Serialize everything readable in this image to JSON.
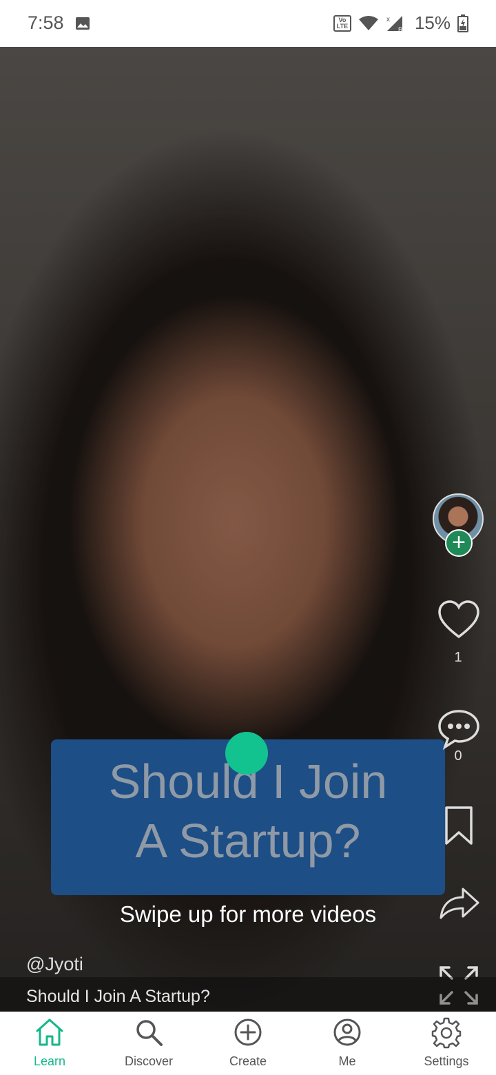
{
  "status_bar": {
    "time": "7:58",
    "battery": "15%",
    "network_badge": "Vo LTE"
  },
  "video": {
    "card_title_line1": "Should I Join",
    "card_title_line2": "A Startup?",
    "swipe_hint": "Swipe up for more videos",
    "author_handle": "@Jyoti",
    "title": "Should I Join A Startup?"
  },
  "actions": {
    "like_count": "1",
    "comment_count": "0"
  },
  "bottom_nav": {
    "items": [
      {
        "label": "Learn",
        "icon": "home-icon",
        "active": true
      },
      {
        "label": "Discover",
        "icon": "search-icon",
        "active": false
      },
      {
        "label": "Create",
        "icon": "plus-circle-icon",
        "active": false
      },
      {
        "label": "Me",
        "icon": "profile-icon",
        "active": false
      },
      {
        "label": "Settings",
        "icon": "gear-icon",
        "active": false
      }
    ]
  },
  "colors": {
    "accent": "#14b889",
    "card_bg": "#1d4e86"
  }
}
